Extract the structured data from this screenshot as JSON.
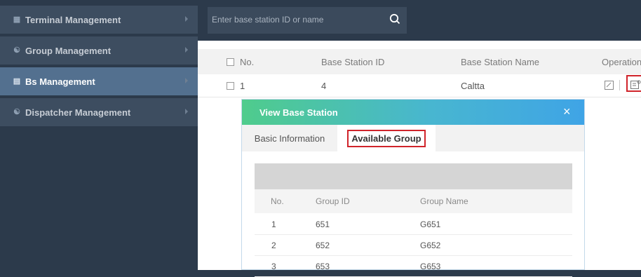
{
  "sidebar": {
    "items": [
      {
        "label": "Terminal Management",
        "icon": "terminal-icon",
        "active": false
      },
      {
        "label": "Group Management",
        "icon": "group-icon",
        "active": false
      },
      {
        "label": "Bs Management",
        "icon": "base-station-icon",
        "active": true
      },
      {
        "label": "Dispatcher Management",
        "icon": "dispatcher-icon",
        "active": false
      }
    ]
  },
  "search": {
    "placeholder": "Enter base station ID or name",
    "icon": "search-icon"
  },
  "table": {
    "columns": [
      "No.",
      "Base Station ID",
      "Base Station Name",
      "Operation"
    ],
    "rows": [
      {
        "no": "1",
        "id": "4",
        "name": "Caltta",
        "actions": [
          "edit-icon",
          "view-icon"
        ]
      }
    ]
  },
  "modal": {
    "title": "View Base Station",
    "close_label": "×",
    "tabs": [
      "Basic Information",
      "Available Group"
    ],
    "active_tab": "Available Group",
    "columns": [
      "No.",
      "Group ID",
      "Group Name"
    ],
    "rows": [
      {
        "no": "1",
        "group_id": "651",
        "group_name": "G651"
      },
      {
        "no": "2",
        "group_id": "652",
        "group_name": "G652"
      },
      {
        "no": "3",
        "group_id": "653",
        "group_name": "G653"
      }
    ]
  },
  "colors": {
    "sidebar": "#2c3a4b",
    "active": "#53708f",
    "highlight": "#d0242b",
    "header_start": "#4fcc8c",
    "header_end": "#3fa4e6"
  }
}
